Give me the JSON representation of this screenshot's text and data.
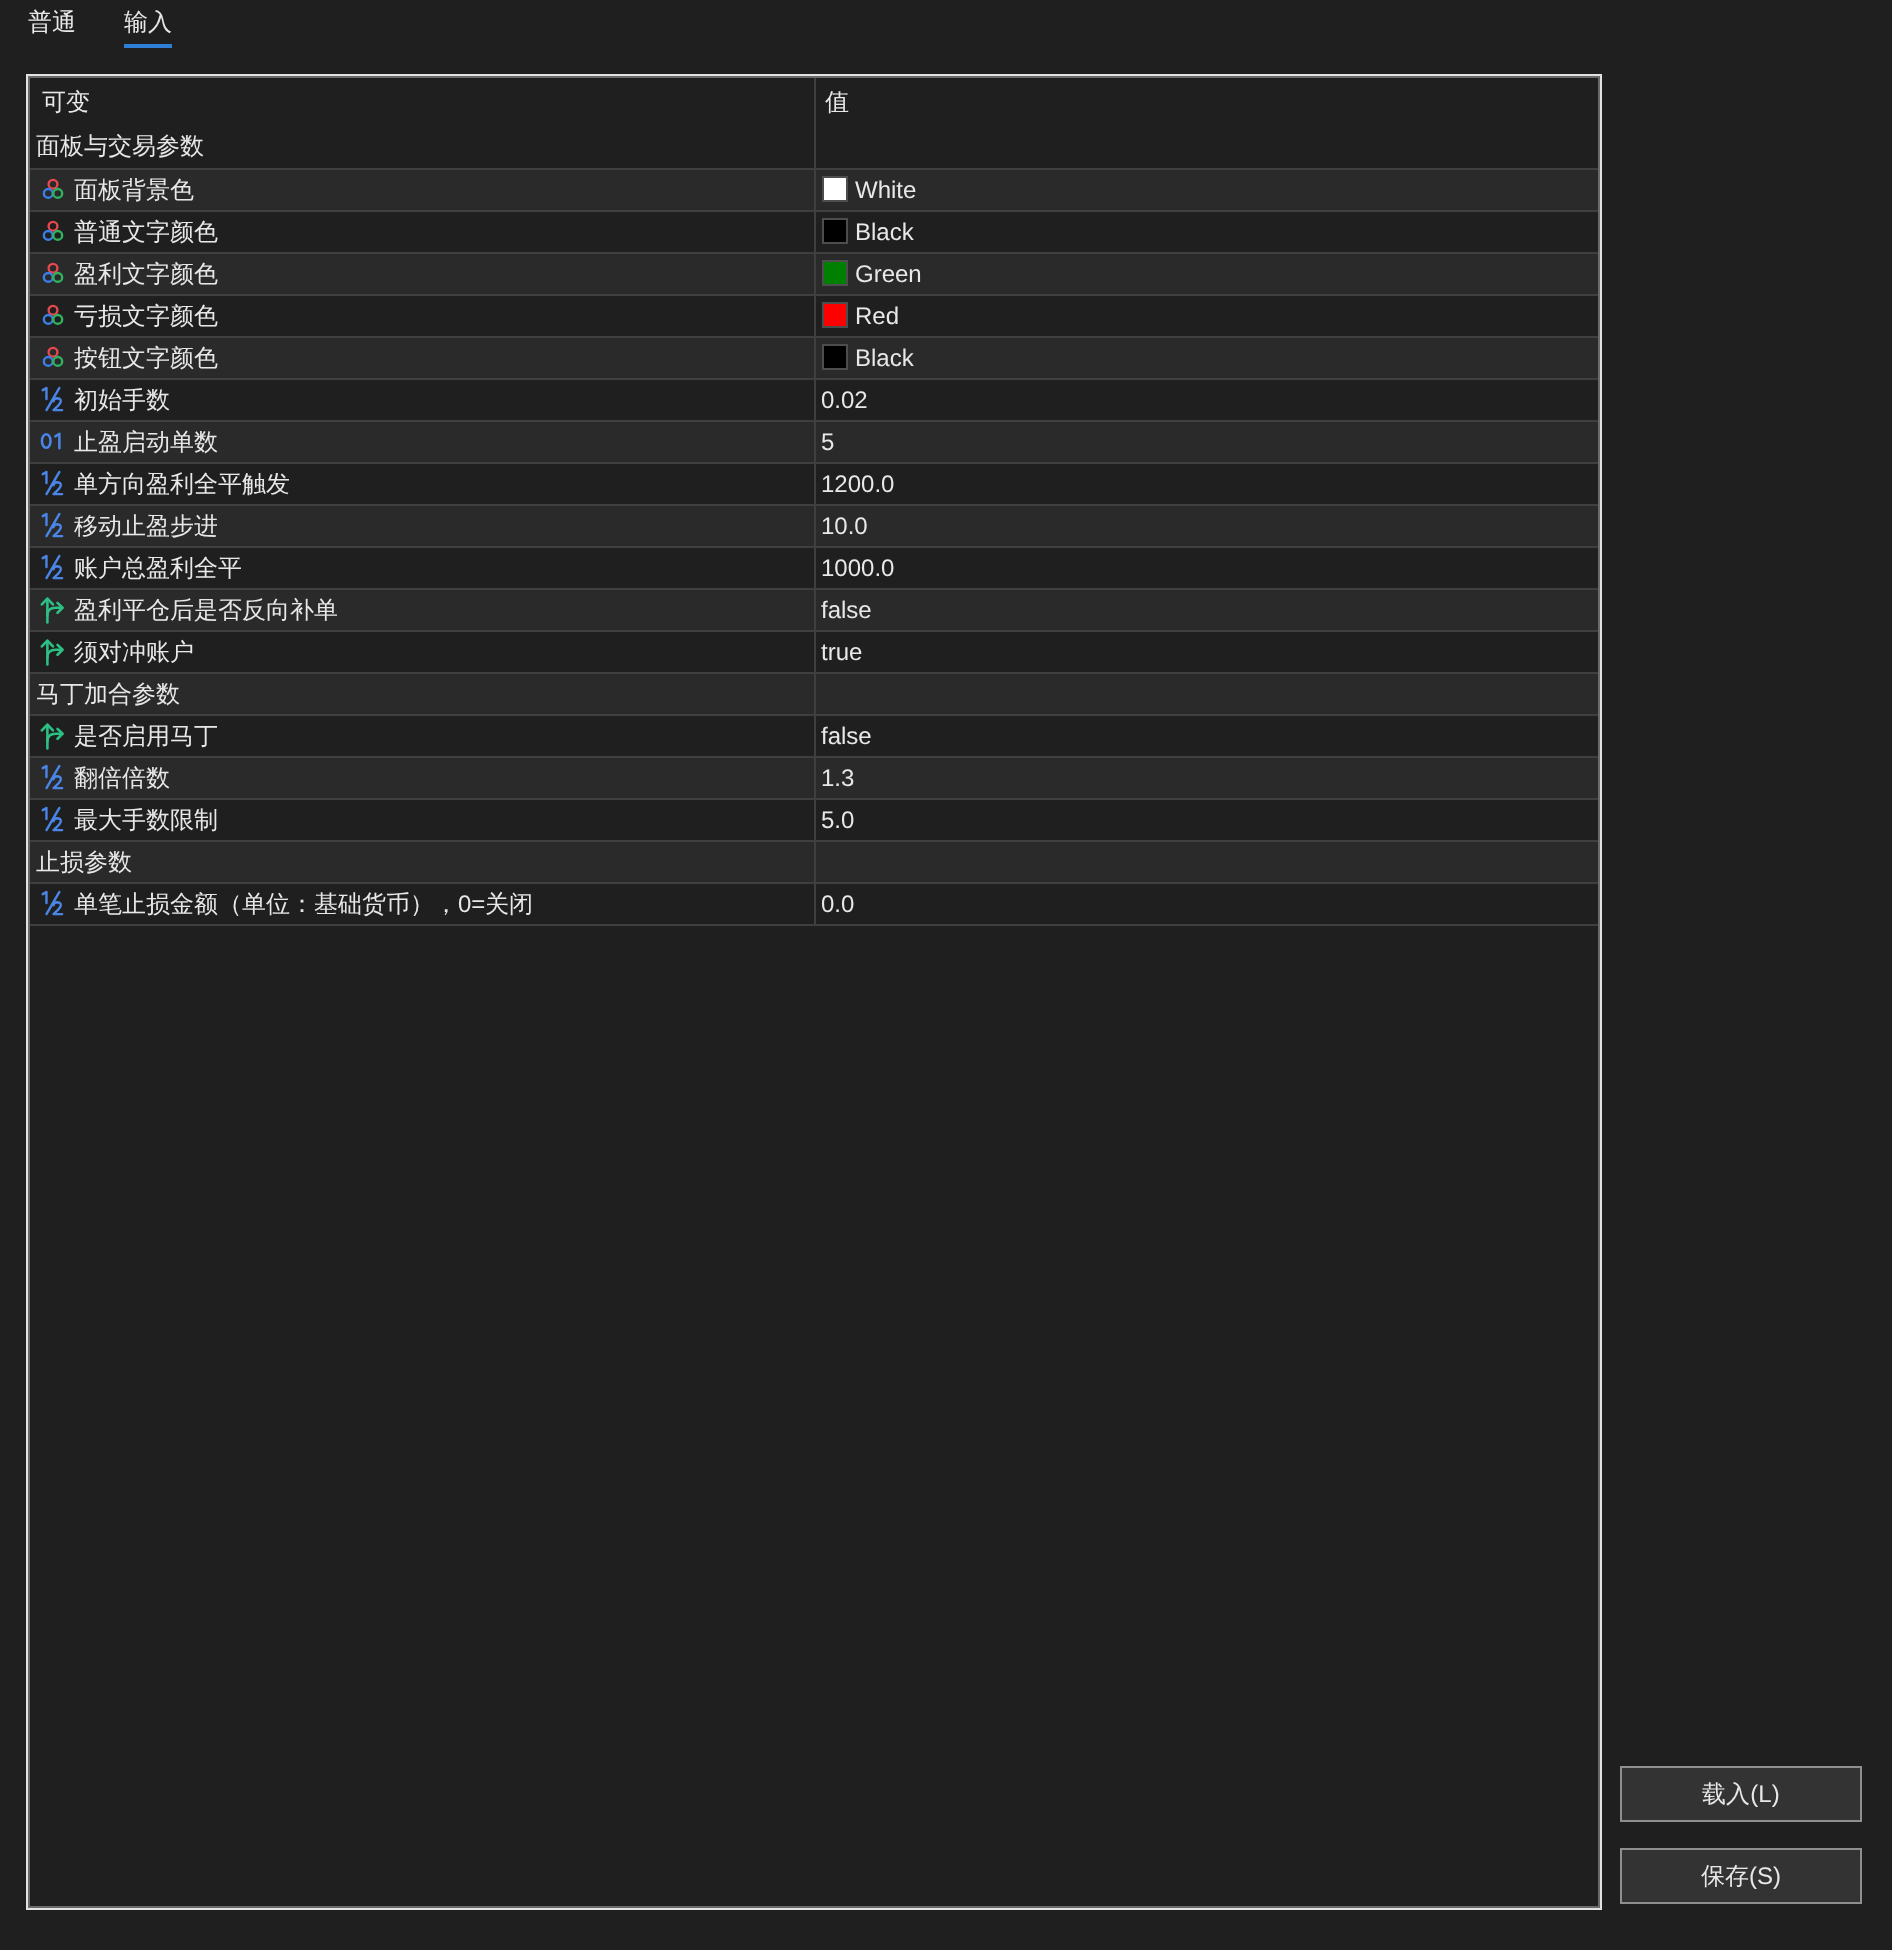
{
  "tabs": [
    {
      "label": "普通",
      "selected": false
    },
    {
      "label": "输入",
      "selected": true
    }
  ],
  "table": {
    "columns": [
      "可变",
      "值"
    ],
    "rows": [
      {
        "kind": "group",
        "name": "面板与交易参数"
      },
      {
        "kind": "color",
        "name": "面板背景色",
        "value": "White",
        "color": "#ffffff"
      },
      {
        "kind": "color",
        "name": "普通文字颜色",
        "value": "Black",
        "color": "#000000"
      },
      {
        "kind": "color",
        "name": "盈利文字颜色",
        "value": "Green",
        "color": "#008000"
      },
      {
        "kind": "color",
        "name": "亏损文字颜色",
        "value": "Red",
        "color": "#ff0000"
      },
      {
        "kind": "color",
        "name": "按钮文字颜色",
        "value": "Black",
        "color": "#000000"
      },
      {
        "kind": "double",
        "name": "初始手数",
        "value": "0.02"
      },
      {
        "kind": "int",
        "name": "止盈启动单数",
        "value": "5"
      },
      {
        "kind": "double",
        "name": "单方向盈利全平触发",
        "value": "1200.0"
      },
      {
        "kind": "double",
        "name": "移动止盈步进",
        "value": "10.0"
      },
      {
        "kind": "double",
        "name": "账户总盈利全平",
        "value": "1000.0"
      },
      {
        "kind": "bool",
        "name": "盈利平仓后是否反向补单",
        "value": "false"
      },
      {
        "kind": "bool",
        "name": "须对冲账户",
        "value": "true"
      },
      {
        "kind": "group",
        "name": "马丁加合参数"
      },
      {
        "kind": "bool",
        "name": "是否启用马丁",
        "value": "false"
      },
      {
        "kind": "double",
        "name": "翻倍倍数",
        "value": "1.3"
      },
      {
        "kind": "double",
        "name": "最大手数限制",
        "value": "5.0"
      },
      {
        "kind": "group",
        "name": "止损参数"
      },
      {
        "kind": "double",
        "name": "单笔止损金额（单位：基础货币），0=关闭",
        "value": "0.0"
      }
    ]
  },
  "buttons": [
    {
      "label": "载入(L)"
    },
    {
      "label": "保存(S)"
    }
  ]
}
